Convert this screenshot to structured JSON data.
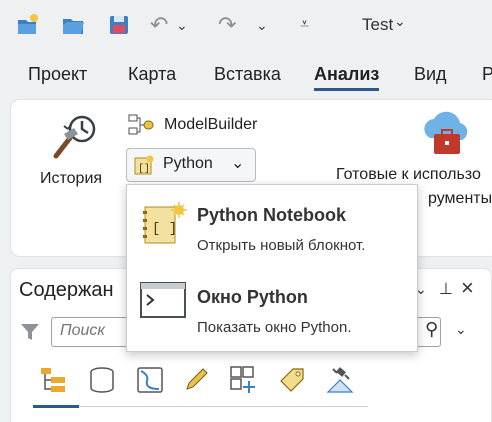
{
  "window": {
    "title": "Test"
  },
  "menu": {
    "tabs": [
      {
        "label": "Проект"
      },
      {
        "label": "Карта"
      },
      {
        "label": "Вставка"
      },
      {
        "label": "Анализ"
      },
      {
        "label": "Вид"
      },
      {
        "label": "Р"
      }
    ],
    "active_tab": "Анализ"
  },
  "ribbon": {
    "history_label": "История",
    "modelbuilder_label": "ModelBuilder",
    "python_label": "Python",
    "ready_tools_line1": "Готовые к использо",
    "ready_tools_line2": "рументы"
  },
  "dropdown": {
    "items": [
      {
        "name": "Python Notebook",
        "description": "Открыть новый блокнот.",
        "icon": "notebook-icon"
      },
      {
        "name": "Окно Python",
        "description": "Показать окно Python.",
        "icon": "python-window-icon"
      }
    ]
  },
  "contents_pane": {
    "title": "Содержан",
    "search_placeholder": "Поиск"
  },
  "colors": {
    "accent": "#2a5a8c",
    "ribbon_bg": "#ffffff",
    "app_bg": "#eef0f2",
    "python_yellow": "#e8c34a",
    "toolbox_red": "#c0392b"
  }
}
